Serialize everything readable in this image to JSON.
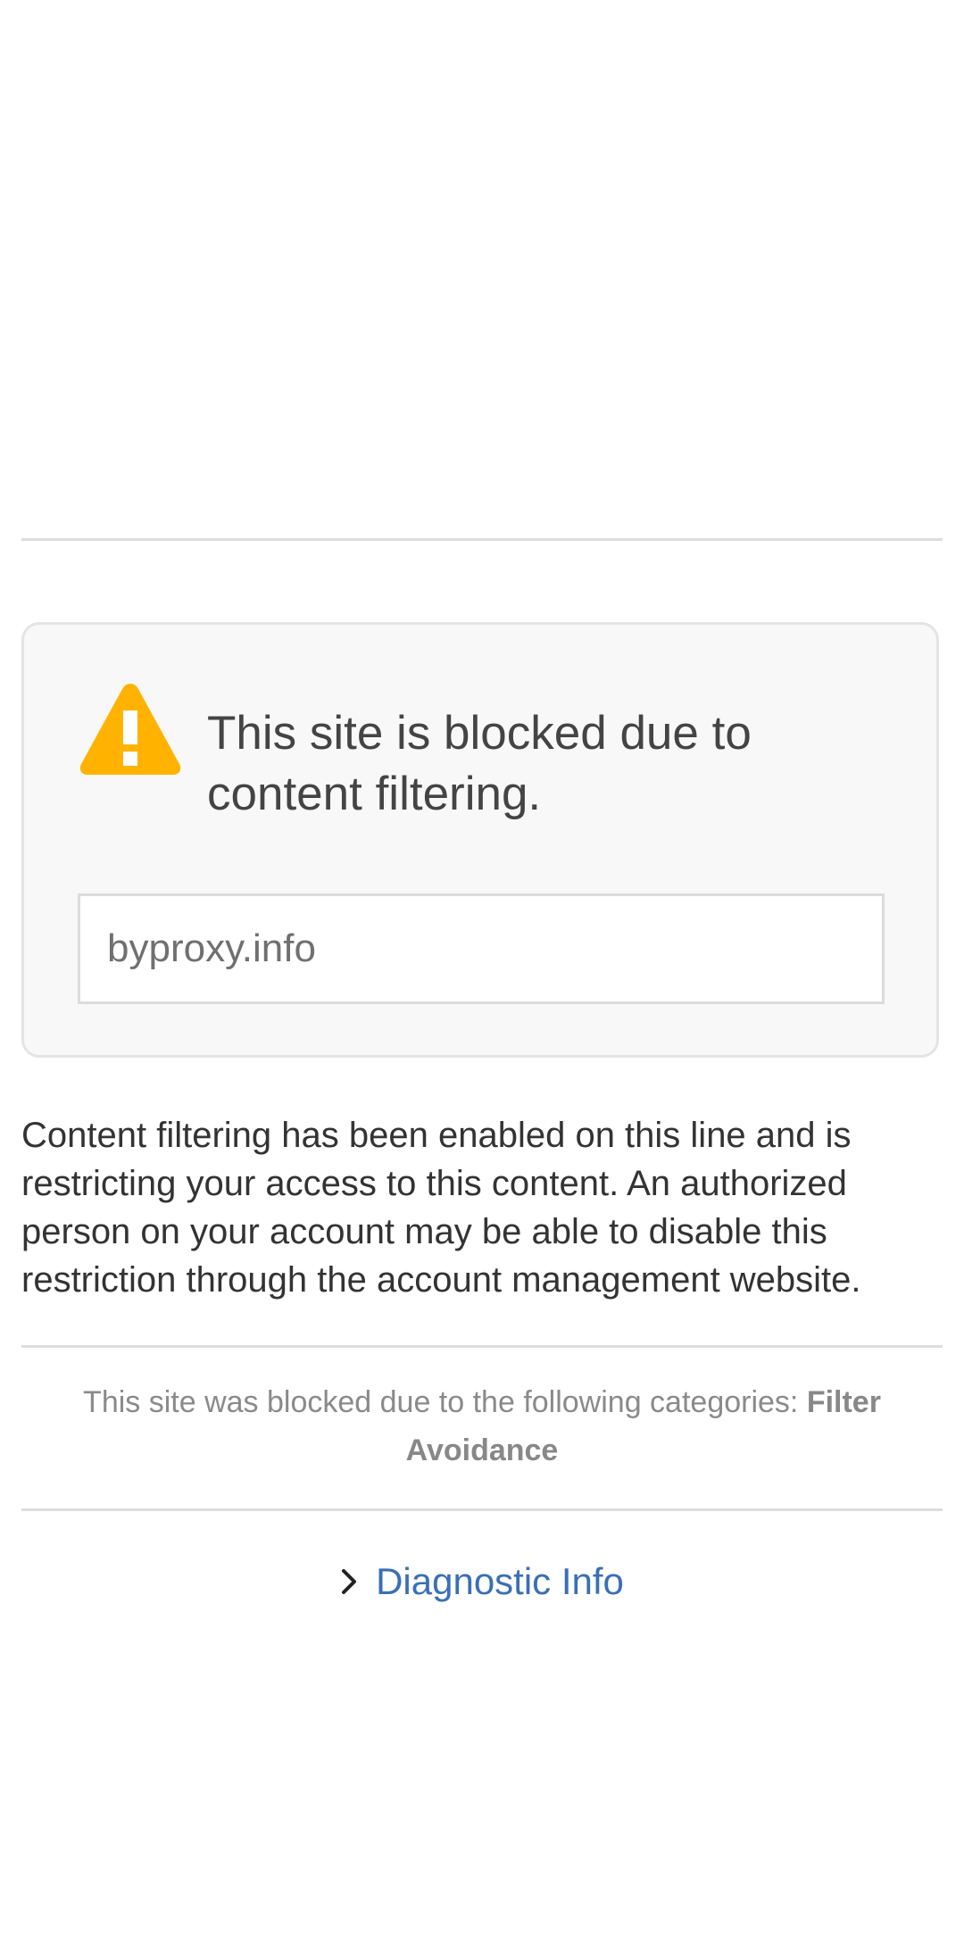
{
  "block": {
    "headline": "This site is blocked due to content filtering.",
    "url": "byproxy.info",
    "icon": "warning-icon",
    "icon_color": "#ffb300"
  },
  "explanation": "Content filtering has been enabled on this line and is restricting your access to this content. An authorized person on your account may be able to disable this restriction through the account management website.",
  "categories": {
    "prefix": "This site was blocked due to the following categories: ",
    "names": "Filter Avoidance"
  },
  "diagnostic": {
    "label": "Diagnostic Info",
    "icon": "chevron-right-icon",
    "link_color": "#3a6fb8"
  }
}
